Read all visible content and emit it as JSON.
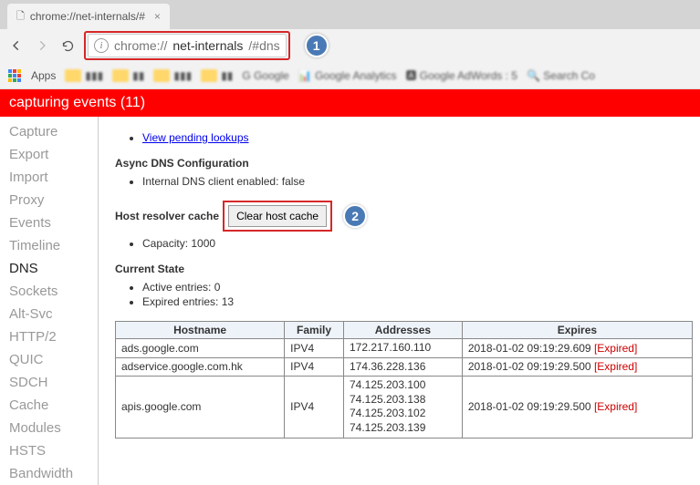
{
  "tab": {
    "title": "chrome://net-internals/#",
    "close": "×"
  },
  "url": {
    "prefix": "chrome://",
    "host": "net-internals",
    "path": "/#dns"
  },
  "bookmarks_label": "Apps",
  "banner": "capturing events (11)",
  "sidebar": {
    "items": [
      {
        "label": "Capture"
      },
      {
        "label": "Export"
      },
      {
        "label": "Import"
      },
      {
        "label": "Proxy"
      },
      {
        "label": "Events"
      },
      {
        "label": "Timeline"
      },
      {
        "label": "DNS"
      },
      {
        "label": "Sockets"
      },
      {
        "label": "Alt-Svc"
      },
      {
        "label": "HTTP/2"
      },
      {
        "label": "QUIC"
      },
      {
        "label": "SDCH"
      },
      {
        "label": "Cache"
      },
      {
        "label": "Modules"
      },
      {
        "label": "HSTS"
      },
      {
        "label": "Bandwidth"
      }
    ],
    "active_index": 6
  },
  "main": {
    "pending_link": "View pending lookups",
    "async_title": "Async DNS Configuration",
    "async_item": "Internal DNS client enabled: false",
    "host_cache_label": "Host resolver cache",
    "clear_btn": "Clear host cache",
    "capacity_item": "Capacity: 1000",
    "current_title": "Current State",
    "active_entries": "Active entries: 0",
    "expired_entries": "Expired entries: 13",
    "cols": {
      "hostname": "Hostname",
      "family": "Family",
      "addresses": "Addresses",
      "expires": "Expires"
    },
    "rows": [
      {
        "hostname": "ads.google.com",
        "family": "IPV4",
        "addresses": [
          "172.217.160.110"
        ],
        "expires": "2018-01-02 09:19:29.609",
        "expired": "[Expired]"
      },
      {
        "hostname": "adservice.google.com.hk",
        "family": "IPV4",
        "addresses": [
          "174.36.228.136"
        ],
        "expires": "2018-01-02 09:19:29.500",
        "expired": "[Expired]"
      },
      {
        "hostname": "apis.google.com",
        "family": "IPV4",
        "addresses": [
          "74.125.203.100",
          "74.125.203.138",
          "74.125.203.102",
          "74.125.203.139"
        ],
        "expires": "2018-01-02 09:19:29.500",
        "expired": "[Expired]"
      }
    ]
  },
  "annotations": {
    "one": "1",
    "two": "2"
  }
}
